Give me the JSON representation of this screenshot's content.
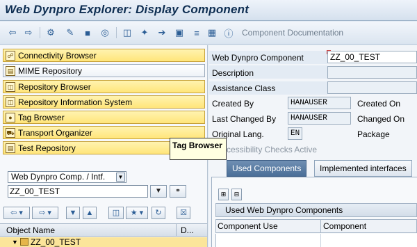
{
  "window": {
    "title": "Web Dynpro Explorer: Display Component"
  },
  "toolbar": {
    "icons": [
      "back-arrow-icon",
      "forward-arrow-icon",
      "other-object-icon",
      "display-change-icon",
      "activate-icon",
      "where-used-icon",
      "hierarchy-icon",
      "wand-icon",
      "move-icon",
      "structure-icon",
      "stack-icon",
      "table-icon",
      "info-icon"
    ],
    "component_documentation": "Component Documentation"
  },
  "navigation": {
    "items": [
      {
        "label": "Connectivity Browser",
        "icon": "connectivity-icon"
      },
      {
        "label": "MIME Repository",
        "icon": "mime-icon"
      },
      {
        "label": "Repository Browser",
        "icon": "repository-icon"
      },
      {
        "label": "Repository Information System",
        "icon": "info-system-icon"
      },
      {
        "label": "Tag Browser",
        "icon": "tag-icon"
      },
      {
        "label": "Transport Organizer",
        "icon": "transport-icon"
      },
      {
        "label": "Test Repository",
        "icon": "test-icon"
      }
    ]
  },
  "tooltip": {
    "text": "Tag Browser"
  },
  "object_selector": {
    "type_value": "Web Dynpro Comp. / Intf.",
    "name_value": "ZZ_00_TEST"
  },
  "object_list": {
    "header_name": "Object Name",
    "header_desc": "D...",
    "rows": [
      {
        "name": "ZZ_00_TEST"
      }
    ]
  },
  "component": {
    "labels": {
      "component": "Web Dynpro Component",
      "description": "Description",
      "assistance_class": "Assistance Class",
      "created_by": "Created By",
      "last_changed_by": "Last Changed By",
      "original_lang": "Original Lang.",
      "created_on": "Created On",
      "changed_on": "Changed On",
      "package": "Package",
      "accessibility": "Accessibility Checks Active"
    },
    "values": {
      "component": "ZZ_00_TEST",
      "created_by": "HANAUSER",
      "last_changed_by": "HANAUSER",
      "original_lang": "EN"
    }
  },
  "tabs": [
    {
      "label": "Used Components",
      "active": true
    },
    {
      "label": "Implemented interfaces",
      "active": false
    }
  ],
  "used_components": {
    "title": "Used Web Dynpro Components",
    "columns": [
      "Component Use",
      "Component"
    ]
  }
}
